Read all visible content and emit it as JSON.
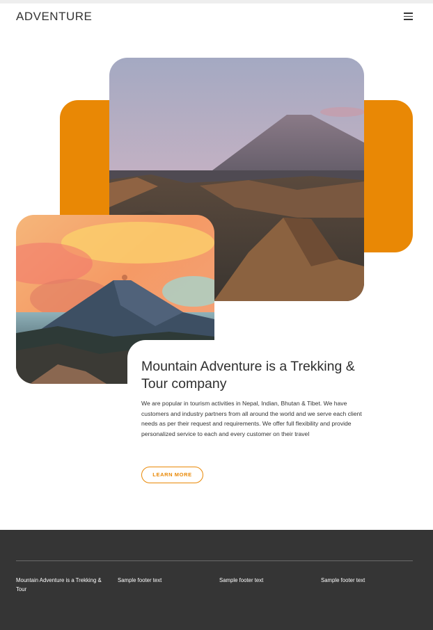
{
  "header": {
    "logo": "ADVENTURE",
    "menu_icon": "hamburger-menu-icon"
  },
  "hero": {
    "accent_color": "#e98805",
    "headline": "Mountain Adventure is a Trekking & Tour company",
    "body": "We are popular in tourism activities in Nepal, Indian, Bhutan & Tibet. We have customers and industry partners from all around the world and we serve each client needs as per their request and requirements. We offer full flexibility and provide personalized service to each and every customer on their travel",
    "button_label": "LEARN MORE"
  },
  "footer": {
    "background": "#353535",
    "columns": [
      "Mountain Adventure is a Trekking & Tour",
      "Sample footer text",
      "Sample footer text",
      "Sample footer text"
    ]
  }
}
